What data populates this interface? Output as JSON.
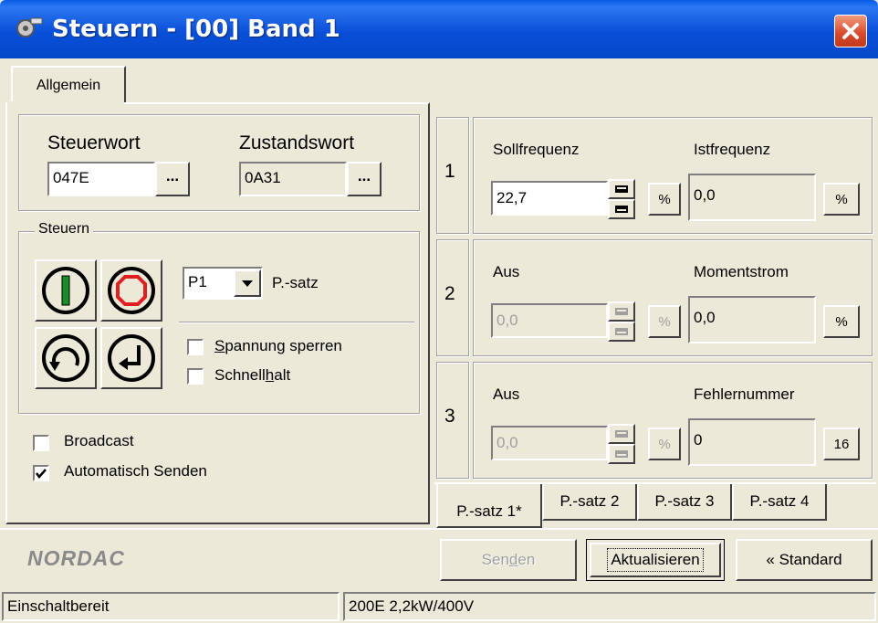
{
  "window": {
    "title": "Steuern - [00] Band 1",
    "icon": "gear-app-icon",
    "close_icon": "close-icon"
  },
  "tabs_top": [
    {
      "label": "Allgemein"
    }
  ],
  "words": {
    "steuerwort_label": "Steuerwort",
    "steuerwort_value": "047E",
    "zustandswort_label": "Zustandswort",
    "zustandswort_value": "0A31",
    "ellipsis": "...",
    "steuern_group": "Steuern",
    "pset_select": "P1",
    "pset_label": "P.-satz",
    "spannung_pre": "",
    "spannung_acc": "S",
    "spannung_post": "pannung sperren",
    "schnell_pre": "Schnell",
    "schnell_acc": "h",
    "schnell_post": "alt",
    "broadcast": "Broadcast",
    "auto_senden": "Automatisch Senden",
    "broadcast_checked": false,
    "auto_senden_checked": true,
    "spannung_checked": false,
    "schnellhalt_checked": false
  },
  "control_buttons": [
    {
      "name": "on-button",
      "icon": "power-on-icon"
    },
    {
      "name": "stop-button",
      "icon": "stop-icon"
    },
    {
      "name": "reverse-button",
      "icon": "direction-reverse-icon"
    },
    {
      "name": "quick-stop-button",
      "icon": "return-icon"
    }
  ],
  "rows": [
    {
      "index": "1",
      "left_label": "Sollfrequenz",
      "left_value": "22,7",
      "left_enabled": true,
      "right_label": "Istfrequenz",
      "right_value": "0,0",
      "right_btn": "%"
    },
    {
      "index": "2",
      "left_label": "Aus",
      "left_value": "0,0",
      "left_enabled": false,
      "right_label": "Momentstrom",
      "right_value": "0,0",
      "right_btn": "%"
    },
    {
      "index": "3",
      "left_label": "Aus",
      "left_value": "0,0",
      "left_enabled": false,
      "right_label": "Fehlernummer",
      "right_value": "0",
      "right_btn": "16"
    }
  ],
  "pct_label": "%",
  "psatz_tabs": [
    {
      "label": "P.-satz 1*",
      "active": true
    },
    {
      "label": "P.-satz 2",
      "active": false
    },
    {
      "label": "P.-satz 3",
      "active": false
    },
    {
      "label": "P.-satz 4",
      "active": false
    }
  ],
  "brand": "NORDAC",
  "buttons": {
    "senden_pre": "Sen",
    "senden_acc": "d",
    "senden_post": "en",
    "aktualisieren": "Aktualisieren",
    "standard": "« Standard"
  },
  "status": {
    "left": "Einschaltbereit",
    "right": "200E 2,2kW/400V"
  },
  "colors": {
    "title_bar": "#0a4fd8",
    "close": "#d9472a",
    "on_icon": "#1a8c2a",
    "stop_icon": "#e02020",
    "window_bg": "#ece9d8"
  }
}
